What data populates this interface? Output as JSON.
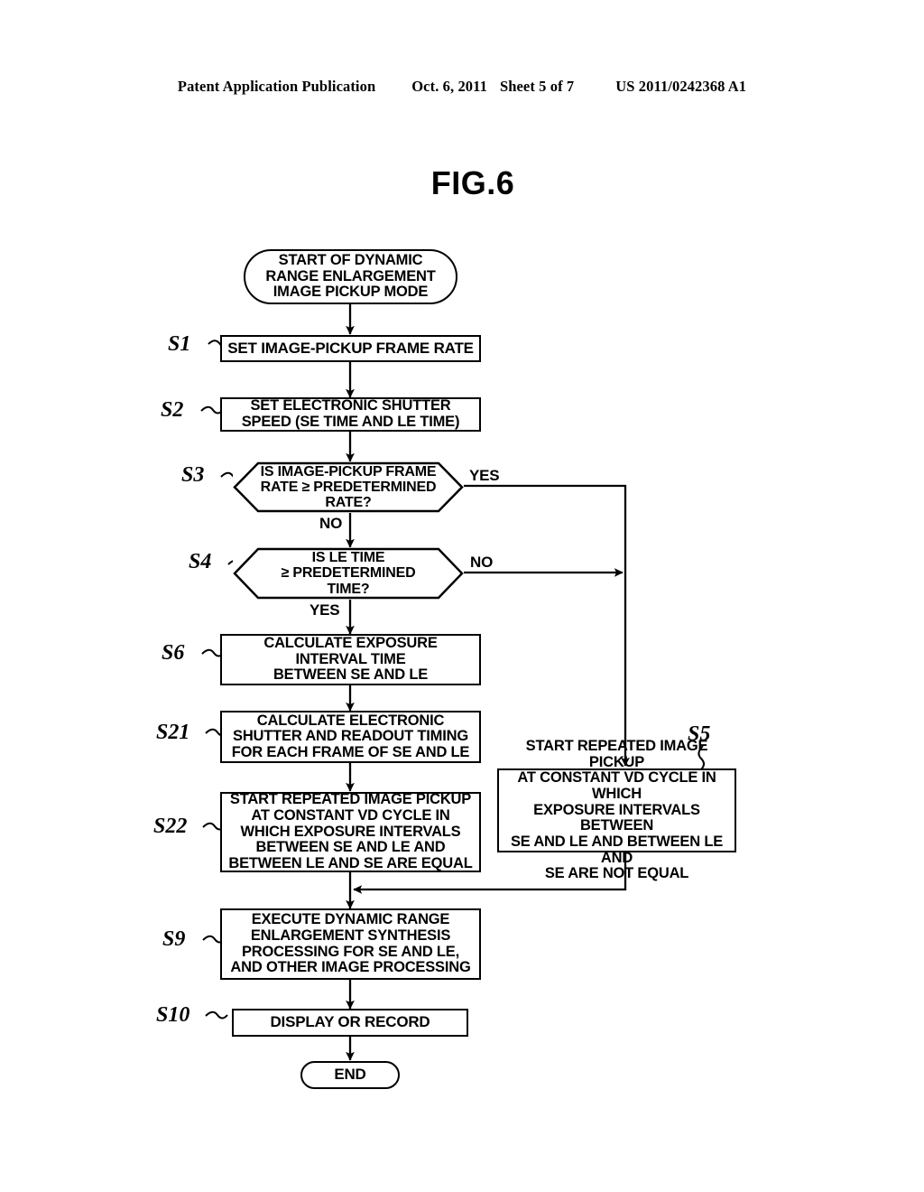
{
  "header": {
    "publication": "Patent Application Publication",
    "date": "Oct. 6, 2011",
    "sheet": "Sheet 5 of 7",
    "docnumber": "US 2011/0242368 A1"
  },
  "figure": {
    "title": "FIG.6"
  },
  "flowchart": {
    "start": {
      "id": "start",
      "text": "START OF DYNAMIC RANGE ENLARGEMENT IMAGE PICKUP MODE",
      "lines": [
        "START OF DYNAMIC",
        "RANGE ENLARGEMENT",
        "IMAGE PICKUP MODE"
      ]
    },
    "end": {
      "id": "end",
      "text": "END",
      "lines": [
        "END"
      ]
    },
    "steps": [
      {
        "id": "S1",
        "label": "S1",
        "shape": "process",
        "text": "SET IMAGE-PICKUP FRAME RATE",
        "lines": [
          "SET IMAGE-PICKUP FRAME RATE"
        ]
      },
      {
        "id": "S2",
        "label": "S2",
        "shape": "process",
        "text": "SET ELECTRONIC SHUTTER SPEED (SE TIME AND LE TIME)",
        "lines": [
          "SET ELECTRONIC SHUTTER",
          "SPEED (SE TIME AND LE TIME)"
        ]
      },
      {
        "id": "S3",
        "label": "S3",
        "shape": "decision",
        "text": "IS IMAGE-PICKUP FRAME RATE ≥ PREDETERMINED RATE?",
        "lines": [
          "IS IMAGE-PICKUP FRAME",
          "RATE ≥ PREDETERMINED",
          "RATE?"
        ],
        "branch_yes": "YES",
        "branch_no": "NO"
      },
      {
        "id": "S4",
        "label": "S4",
        "shape": "decision",
        "text": "IS LE TIME ≥ PREDETERMINED TIME?",
        "lines": [
          "IS LE TIME",
          "≥ PREDETERMINED",
          "TIME?"
        ],
        "branch_yes": "YES",
        "branch_no": "NO"
      },
      {
        "id": "S6",
        "label": "S6",
        "shape": "process",
        "text": "CALCULATE EXPOSURE INTERVAL TIME BETWEEN SE AND LE",
        "lines": [
          "CALCULATE EXPOSURE",
          "INTERVAL TIME",
          "BETWEEN SE AND LE"
        ]
      },
      {
        "id": "S21",
        "label": "S21",
        "shape": "process",
        "text": "CALCULATE ELECTRONIC SHUTTER AND READOUT TIMING FOR EACH FRAME OF SE AND LE",
        "lines": [
          "CALCULATE ELECTRONIC",
          "SHUTTER AND READOUT TIMING",
          "FOR EACH FRAME OF SE AND LE"
        ]
      },
      {
        "id": "S22",
        "label": "S22",
        "shape": "process",
        "text": "START REPEATED IMAGE PICKUP AT CONSTANT VD CYCLE IN WHICH EXPOSURE INTERVALS BETWEEN SE AND LE AND BETWEEN LE AND SE ARE EQUAL",
        "lines": [
          "START REPEATED IMAGE PICKUP",
          "AT CONSTANT VD CYCLE IN",
          "WHICH EXPOSURE INTERVALS",
          "BETWEEN SE AND LE AND",
          "BETWEEN LE AND SE ARE EQUAL"
        ]
      },
      {
        "id": "S5",
        "label": "S5",
        "shape": "process",
        "text": "START REPEATED IMAGE PICKUP AT CONSTANT VD CYCLE IN WHICH EXPOSURE INTERVALS BETWEEN SE AND LE AND BETWEEN LE AND SE ARE NOT EQUAL",
        "lines": [
          "START REPEATED IMAGE PICKUP",
          "AT CONSTANT VD CYCLE IN WHICH",
          "EXPOSURE INTERVALS BETWEEN",
          "SE AND LE AND BETWEEN LE AND",
          "SE ARE NOT EQUAL"
        ]
      },
      {
        "id": "S9",
        "label": "S9",
        "shape": "process",
        "text": "EXECUTE DYNAMIC RANGE ENLARGEMENT SYNTHESIS PROCESSING FOR SE AND LE, AND OTHER IMAGE PROCESSING",
        "lines": [
          "EXECUTE DYNAMIC RANGE",
          "ENLARGEMENT SYNTHESIS",
          "PROCESSING FOR SE AND LE,",
          "AND OTHER IMAGE PROCESSING"
        ]
      },
      {
        "id": "S10",
        "label": "S10",
        "shape": "process",
        "text": "DISPLAY OR RECORD",
        "lines": [
          "DISPLAY OR RECORD"
        ]
      }
    ],
    "branch_labels": {
      "s3_yes": "YES",
      "s3_no": "NO",
      "s4_no": "NO",
      "s4_yes": "YES"
    },
    "colors": {
      "ink": "#000000",
      "paper": "#ffffff"
    }
  }
}
